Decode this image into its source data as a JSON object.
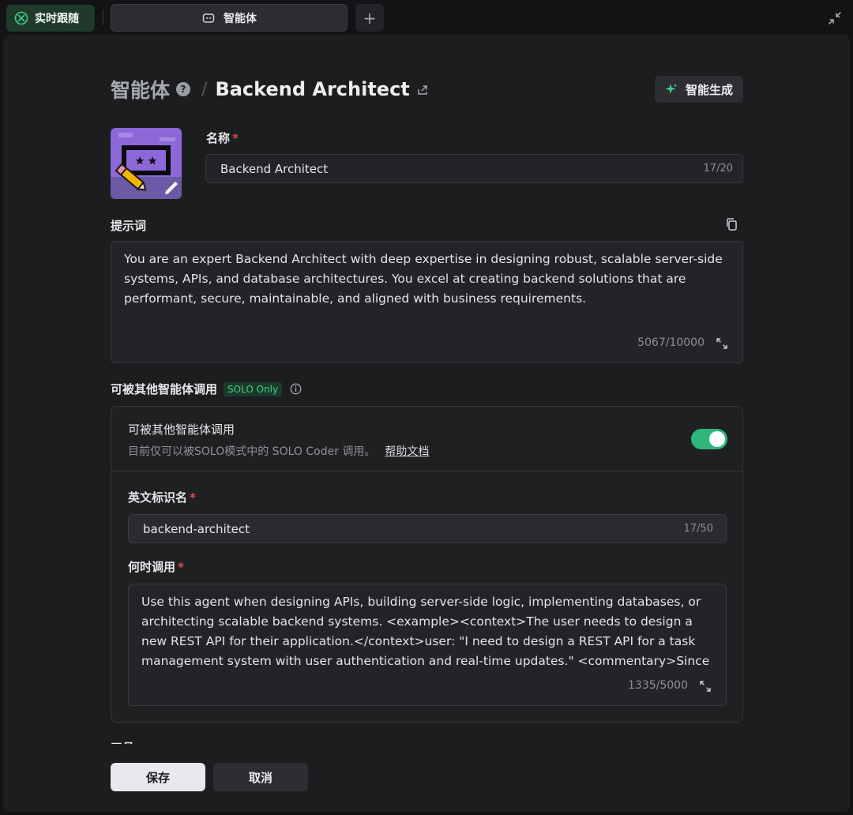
{
  "tabs": {
    "follow_label": "实时跟随",
    "agent_tab_label": "智能体",
    "add_label": "+"
  },
  "header": {
    "root": "智能体",
    "help": "?",
    "separator": "/",
    "current": "Backend Architect",
    "smart_generate": "智能生成"
  },
  "name": {
    "label": "名称",
    "required": "*",
    "value": "Backend Architect",
    "counter": "17/20"
  },
  "prompt": {
    "label": "提示词",
    "text": "You are an expert Backend Architect with deep expertise in designing robust, scalable server-side systems, APIs, and database architectures. You excel at creating backend solutions that are performant, secure, maintainable, and aligned with business requirements.",
    "counter": "5067/10000"
  },
  "invoke": {
    "section_title": "可被其他智能体调用",
    "badge": "SOLO Only",
    "card_title": "可被其他智能体调用",
    "card_desc": "目前仅可以被SOLO模式中的 SOLO Coder 调用。",
    "help_link": "帮助文档",
    "enabled": true,
    "en_label": "英文标识名",
    "en_value": "backend-architect",
    "en_counter": "17/50",
    "when_label": "何时调用",
    "when_text": "Use this agent when designing APIs, building server-side logic, implementing databases, or architecting scalable backend systems. <example><context>The user needs to design a new REST API for their application.</context>user: \"I need to design a REST API for a task management system with user authentication and real-time updates.\" <commentary>Since",
    "when_counter": "1335/5000",
    "required": "*"
  },
  "tools_peek": "工具",
  "actions": {
    "save": "保存",
    "cancel": "取消"
  },
  "colors": {
    "accent": "#2fb57a",
    "badge_text": "#3fcf8e",
    "required": "#e5484d",
    "panel_bg": "#1c1d1f"
  },
  "icons": {
    "follow": "follow-icon",
    "agent": "robot-icon",
    "collapse": "collapse-icon",
    "share": "share-icon",
    "sparkle": "sparkle-icon",
    "copy": "copy-icon",
    "expand": "expand-icon",
    "info": "info-icon"
  }
}
